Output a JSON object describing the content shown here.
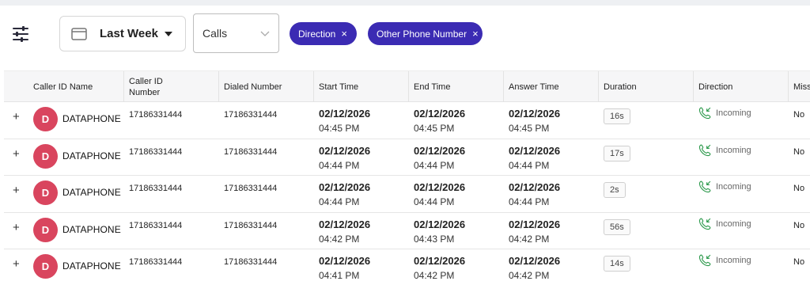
{
  "toolbar": {
    "date_range_label": "Last Week",
    "record_type_label": "Calls",
    "chips": [
      {
        "label": "Direction",
        "remove": "×"
      },
      {
        "label": "Other Phone Number",
        "remove": "×"
      }
    ]
  },
  "table": {
    "columns": [
      "Caller ID Name",
      "Caller ID Number",
      "Dialed Number",
      "Start Time",
      "End Time",
      "Answer Time",
      "Duration",
      "Direction",
      "Missed"
    ],
    "column_header_lines": {
      "caller_id_number": [
        "Caller ID",
        "Number"
      ],
      "missed_visible": "Miss"
    },
    "rows": [
      {
        "avatar": "D",
        "name": "DATAPHONE",
        "caller_number": "17186331444",
        "dialed": "17186331444",
        "start_date": "02/12/2026",
        "start_time": "04:45 PM",
        "end_date": "02/12/2026",
        "end_time": "04:45 PM",
        "answer_date": "02/12/2026",
        "answer_time": "04:45 PM",
        "duration": "16s",
        "direction": "Incoming",
        "missed": "No"
      },
      {
        "avatar": "D",
        "name": "DATAPHONE",
        "caller_number": "17186331444",
        "dialed": "17186331444",
        "start_date": "02/12/2026",
        "start_time": "04:44 PM",
        "end_date": "02/12/2026",
        "end_time": "04:44 PM",
        "answer_date": "02/12/2026",
        "answer_time": "04:44 PM",
        "duration": "17s",
        "direction": "Incoming",
        "missed": "No"
      },
      {
        "avatar": "D",
        "name": "DATAPHONE",
        "caller_number": "17186331444",
        "dialed": "17186331444",
        "start_date": "02/12/2026",
        "start_time": "04:44 PM",
        "end_date": "02/12/2026",
        "end_time": "04:44 PM",
        "answer_date": "02/12/2026",
        "answer_time": "04:44 PM",
        "duration": "2s",
        "direction": "Incoming",
        "missed": "No"
      },
      {
        "avatar": "D",
        "name": "DATAPHONE",
        "caller_number": "17186331444",
        "dialed": "17186331444",
        "start_date": "02/12/2026",
        "start_time": "04:42 PM",
        "end_date": "02/12/2026",
        "end_time": "04:43 PM",
        "answer_date": "02/12/2026",
        "answer_time": "04:42 PM",
        "duration": "56s",
        "direction": "Incoming",
        "missed": "No"
      },
      {
        "avatar": "D",
        "name": "DATAPHONE",
        "caller_number": "17186331444",
        "dialed": "17186331444",
        "start_date": "02/12/2026",
        "start_time": "04:41 PM",
        "end_date": "02/12/2026",
        "end_time": "04:42 PM",
        "answer_date": "02/12/2026",
        "answer_time": "04:42 PM",
        "duration": "14s",
        "direction": "Incoming",
        "missed": "No"
      }
    ]
  },
  "icons": {
    "filter": "sliders-icon",
    "calendar": "calendar-icon",
    "dropdown": "chevron-down-icon",
    "direction": "incoming-call-icon",
    "expand": "plus-icon"
  },
  "colors": {
    "chip_bg": "#3b2bb3",
    "avatar_bg": "#d9455e",
    "incoming_green": "#2e9a4d"
  }
}
